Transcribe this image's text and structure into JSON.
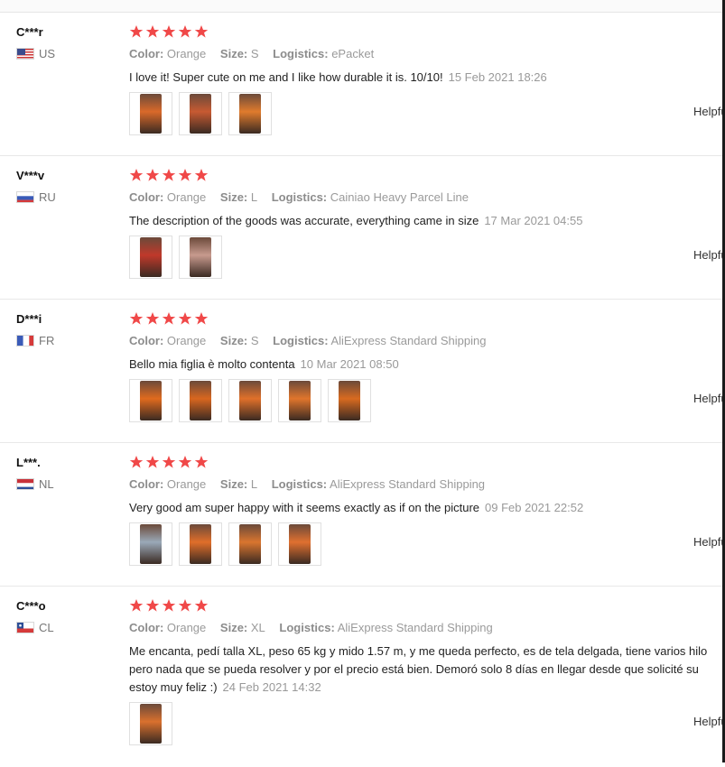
{
  "helpful_label": "Helpful",
  "star_color": "#f04848",
  "reviews": [
    {
      "user": "C***r",
      "country": "US",
      "rating": 5,
      "color_label": "Color:",
      "color": "Orange",
      "size_label": "Size:",
      "size": "S",
      "logistics_label": "Logistics:",
      "logistics": "ePacket",
      "text_lines": [
        "I love it! Super cute on me and I like how durable it is. 10/10!"
      ],
      "date": "15 Feb 2021 18:26",
      "photo_count": 3
    },
    {
      "user": "V***v",
      "country": "RU",
      "rating": 5,
      "color_label": "Color:",
      "color": "Orange",
      "size_label": "Size:",
      "size": "L",
      "logistics_label": "Logistics:",
      "logistics": "Cainiao Heavy Parcel Line",
      "text_lines": [
        "The description of the goods was accurate, everything came in size"
      ],
      "date": "17 Mar 2021 04:55",
      "photo_count": 2
    },
    {
      "user": "D***i",
      "country": "FR",
      "rating": 5,
      "color_label": "Color:",
      "color": "Orange",
      "size_label": "Size:",
      "size": "S",
      "logistics_label": "Logistics:",
      "logistics": "AliExpress Standard Shipping",
      "text_lines": [
        "Bello mia figlia è molto contenta"
      ],
      "date": "10 Mar 2021 08:50",
      "photo_count": 5
    },
    {
      "user": "L***.",
      "country": "NL",
      "rating": 5,
      "color_label": "Color:",
      "color": "Orange",
      "size_label": "Size:",
      "size": "L",
      "logistics_label": "Logistics:",
      "logistics": "AliExpress Standard Shipping",
      "text_lines": [
        "Very good am super happy with it seems exactly as if on the picture"
      ],
      "date": "09 Feb 2021 22:52",
      "photo_count": 4
    },
    {
      "user": "C***o",
      "country": "CL",
      "rating": 5,
      "color_label": "Color:",
      "color": "Orange",
      "size_label": "Size:",
      "size": "XL",
      "logistics_label": "Logistics:",
      "logistics": "AliExpress Standard Shipping",
      "text_lines": [
        "Me encanta, pedí talla XL, peso 65 kg y mido 1.57 m, y me queda perfecto, es de tela delgada, tiene varios hilo",
        "pero nada que se pueda resolver y por el precio está bien. Demoró solo 8 días en llegar desde que solicité su",
        "estoy muy feliz :)"
      ],
      "date": "24 Feb 2021 14:32",
      "photo_count": 1
    }
  ]
}
